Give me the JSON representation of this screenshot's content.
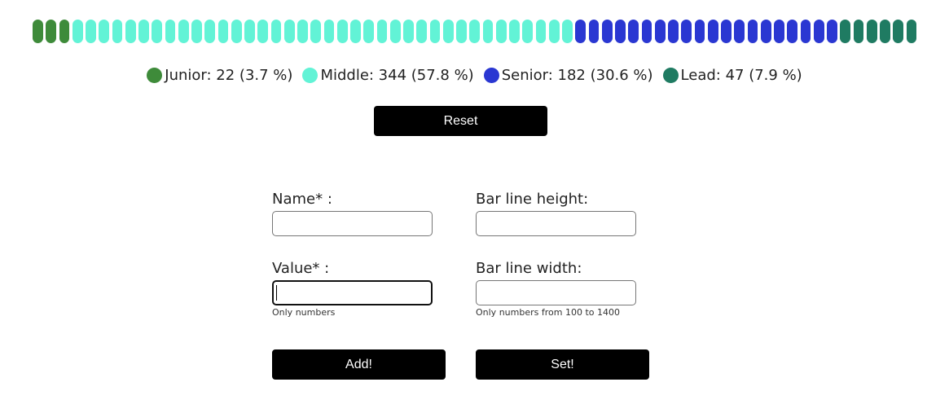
{
  "bar": {
    "segments": [
      {
        "category": "Junior",
        "count": 3,
        "color": "#3e8b3a"
      },
      {
        "category": "Middle",
        "count": 38,
        "color": "#62f3d6"
      },
      {
        "category": "Senior",
        "count": 20,
        "color": "#2a37d2"
      },
      {
        "category": "Lead",
        "count": 6,
        "color": "#1f7b62"
      }
    ]
  },
  "legend": [
    {
      "text": "Junior: 22 (3.7 %)",
      "color": "#3e8b3a"
    },
    {
      "text": "Middle: 344 (57.8 %)",
      "color": "#62f3d6"
    },
    {
      "text": "Senior: 182 (30.6 %)",
      "color": "#2a37d2"
    },
    {
      "text": "Lead: 47 (7.9 %)",
      "color": "#1f7b62"
    }
  ],
  "reset_label": "Reset",
  "form": {
    "name_label": "Name* :",
    "name_value": "",
    "value_label": "Value* :",
    "value_value": "",
    "value_hint": "Only numbers",
    "height_label": "Bar line height:",
    "height_value": "",
    "width_label": "Bar line width:",
    "width_value": "",
    "width_hint": "Only numbers from 100 to 1400",
    "add_label": "Add!",
    "set_label": "Set!"
  }
}
